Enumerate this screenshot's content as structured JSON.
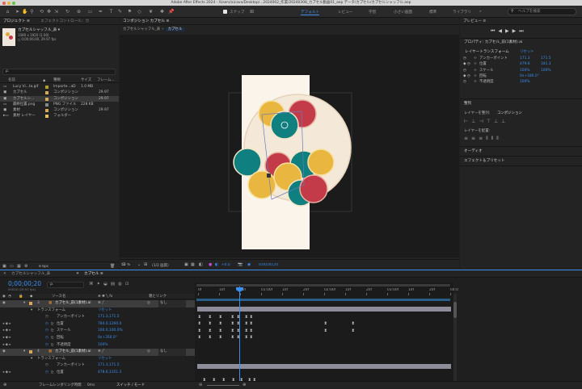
{
  "title_bar": {
    "text": "Adobe After Effects 2024 - /Users/aicavo/Desktop/...2024002_作業/20240308_カプセル動画01_aep データ/カプセル/カプセルシャッフル.aep"
  },
  "toolbar": {
    "snap_label": "スナップ",
    "workspaces": [
      "デフォルト",
      "レビュー",
      "学習",
      "小さい画面",
      "標準",
      "ライブラリ"
    ],
    "active_workspace": "デフォルト",
    "search_placeholder": "ヘルプを検索"
  },
  "project_panel": {
    "tabs": [
      "プロジェクト ≡",
      "エフェクトコントロール：カ"
    ],
    "preview_name": "カプセルシャッフル_表 ▾",
    "preview_info": [
      "1080 x 1920 (1.00)",
      "△ 0;00;06;00, 29.97 fps"
    ],
    "search_placeholder": "ρ.",
    "columns": [
      "名前",
      "種類",
      "サイズ",
      "フレーム..."
    ],
    "items": [
      {
        "name": "Lucy Vi...ta.gif",
        "type": "Importe...aD",
        "size": "1.0 MB",
        "fps": "",
        "color": "#b0a030"
      },
      {
        "name": "カプセル",
        "type": "コンポジション",
        "size": "",
        "fps": "29.97",
        "color": "#d6a85a"
      },
      {
        "name": "カプセルシ...",
        "type": "コンポジション",
        "size": "",
        "fps": "29.97",
        "color": "#d6a85a"
      },
      {
        "name": "最終位置.png",
        "type": "PNG ファイル",
        "size": "228 KB",
        "fps": "",
        "color": "#888888"
      },
      {
        "name": "素材",
        "type": "コンポジション",
        "size": "",
        "fps": "29.97",
        "color": "#d6a85a"
      },
      {
        "name": "素材 レイヤー",
        "type": "フォルダー",
        "size": "",
        "fps": "",
        "color": "#e2c15a"
      }
    ],
    "footer": {
      "bpc": "8 bpc"
    }
  },
  "comp_panel": {
    "tab": "コンポジション カプセル ≡",
    "breadcrumbs": [
      "カプセルシャッフル_表",
      "カプセル"
    ],
    "zoom": "50 %",
    "resolution": "(1/2 画質)",
    "timecode": "0;00;00;20",
    "exposure": "+0.0"
  },
  "preview_panel": {
    "title": "プレビュー ≡"
  },
  "properties_panel": {
    "header": "プロパティ: カプセル_前(1素材).ai",
    "section": "レイヤートランスフォーム",
    "reset": "リセット",
    "props": [
      {
        "label": "アンカーポイント",
        "v1": "171.3",
        "v2": "171.5"
      },
      {
        "label": "位置",
        "v1": "479.6",
        "v2": "341.3"
      },
      {
        "label": "スケール",
        "v1": "100%",
        "v2": "100%"
      },
      {
        "label": "回転",
        "v1": "0x+180.0°",
        "v2": ""
      },
      {
        "label": "不透明度",
        "v1": "100%",
        "v2": ""
      }
    ]
  },
  "align_panel": {
    "title": "整列",
    "align_to_label": "レイヤーを整列:",
    "align_to_value": "コンポジション",
    "distribute_label": "レイヤーを配置:"
  },
  "audio_panel": {
    "title": "オーディオ"
  },
  "effects_panel": {
    "title": "エフェクト＆プリセット"
  },
  "timeline": {
    "tabs": [
      "カプセルシャッフル_表",
      "カプセル ≡"
    ],
    "timecode": "0;00;00;20",
    "timecode_sub": "00020 (29.97 fps)",
    "search_placeholder": "ρ.",
    "col_source": "ソース名",
    "col_parent": "親とリンク",
    "ruler": [
      "0f",
      "10f",
      "20f",
      "01:00f",
      "10f",
      "20f",
      "02:00f",
      "10f",
      "20f",
      "03:00f",
      "10f",
      "20f",
      "04:0"
    ],
    "layers": [
      {
        "num": "3",
        "name": "カプセル_前(1素材).ai",
        "parent": "なし",
        "transform": "トランスフォーム",
        "reset": "リセット",
        "props": [
          {
            "label": "アンカーポイント",
            "value": "171.3,171.5"
          },
          {
            "label": "位置",
            "value": "784.0,1260.0"
          },
          {
            "label": "スケール",
            "value": "100.0,100.0%"
          },
          {
            "label": "回転",
            "value": "0x+350.0°"
          },
          {
            "label": "不透明度",
            "value": "100%"
          }
        ]
      },
      {
        "num": "4",
        "name": "カプセル_前(1素材).ai",
        "parent": "なし",
        "transform": "トランスフォーム",
        "reset": "リセット",
        "props": [
          {
            "label": "アンカーポイント",
            "value": "171.3,171.5"
          },
          {
            "label": "位置",
            "value": "478.6,1351.3"
          }
        ]
      }
    ],
    "footer_render": "フレームレンダリング時間",
    "footer_time": "0ms",
    "footer_switch": "スイッチ / モード"
  }
}
